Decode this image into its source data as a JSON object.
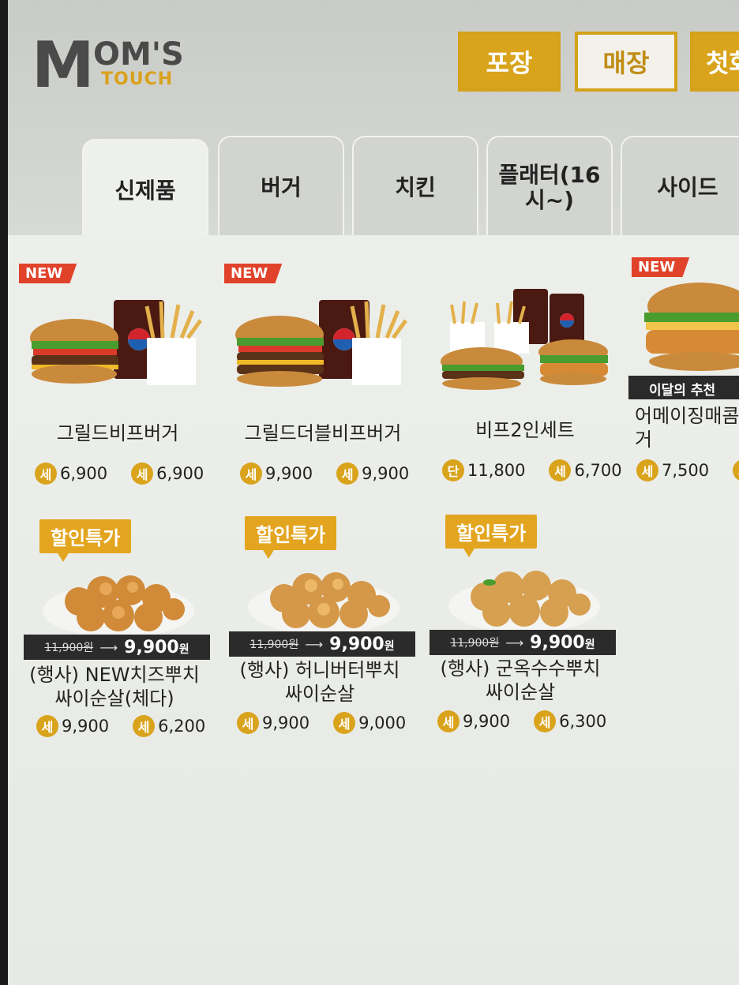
{
  "brand": {
    "logo_m": "M",
    "logo_oms": "OM'S",
    "logo_touch": "TOUCH"
  },
  "mode": {
    "takeout": "포장",
    "dinein": "매장",
    "first": "첫화"
  },
  "tabs": [
    "신제품",
    "버거",
    "치킨",
    "플래터(16\n시~)",
    "사이드"
  ],
  "colors": {
    "accent": "#d9a31c",
    "new_badge": "#e0432a",
    "dark_bar": "#2b2b2b"
  },
  "products": [
    {
      "badge": "NEW",
      "name": "그릴드비프버거",
      "p1_tag": "세",
      "p1": "6,900",
      "p2_tag": "세",
      "p2": "6,900"
    },
    {
      "badge": "NEW",
      "name": "그릴드더블비프버거",
      "p1_tag": "세",
      "p1": "9,900",
      "p2_tag": "세",
      "p2": "9,900"
    },
    {
      "badge": "",
      "name": "비프2인세트",
      "p1_tag": "단",
      "p1": "11,800",
      "p2_tag": "세",
      "p2": "6,700"
    },
    {
      "badge": "NEW",
      "name": "어메이징매콤\n거",
      "p1_tag": "세",
      "p1": "7,500",
      "p2_tag": "세",
      "p2": "",
      "recommend": "이달의 추천"
    }
  ],
  "deals": [
    {
      "badge": "할인특가",
      "old": "11,900원",
      "new": "9,900",
      "won": "원",
      "name": "(행사) NEW치즈뿌치\n싸이순살(체다)",
      "p1_tag": "세",
      "p1": "9,900",
      "p2_tag": "세",
      "p2": "6,200"
    },
    {
      "badge": "할인특가",
      "old": "11,900원",
      "new": "9,900",
      "won": "원",
      "name": "(행사) 허니버터뿌치\n싸이순살",
      "p1_tag": "세",
      "p1": "9,900",
      "p2_tag": "세",
      "p2": "9,000"
    },
    {
      "badge": "할인특가",
      "old": "11,900원",
      "new": "9,900",
      "won": "원",
      "name": "(행사) 군옥수수뿌치\n싸이순살",
      "p1_tag": "세",
      "p1": "9,900",
      "p2_tag": "세",
      "p2": "6,300"
    }
  ]
}
